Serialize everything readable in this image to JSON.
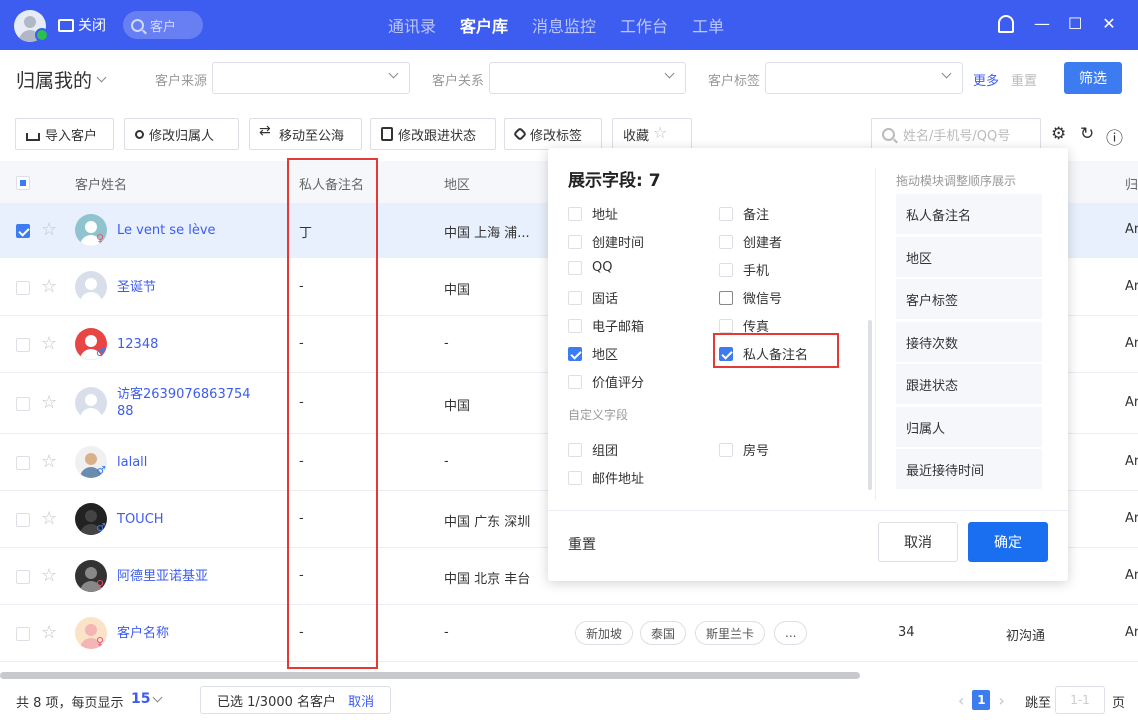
{
  "topbar": {
    "close_label": "关闭",
    "search_placeholder": "客户",
    "nav": [
      "通讯录",
      "客户库",
      "消息监控",
      "工作台",
      "工单"
    ],
    "active_nav": "客户库"
  },
  "filters": {
    "owner": "归属我的",
    "source_label": "客户来源",
    "relation_label": "客户关系",
    "tag_label": "客户标签",
    "more": "更多",
    "reset": "重置",
    "filter_btn": "筛选"
  },
  "toolbar": {
    "import": "导入客户",
    "change_owner": "修改归属人",
    "move_public": "移动至公海",
    "change_status": "修改跟进状态",
    "change_tag": "修改标签",
    "favorite": "收藏",
    "search_placeholder": "姓名/手机号/QQ号"
  },
  "table": {
    "headers": {
      "name": "客户姓名",
      "private_note": "私人备注名",
      "region": "地区",
      "owner_short": "归"
    },
    "rows": [
      {
        "name": "Le vent se lève",
        "note": "丁",
        "region": "中国 上海 浦...",
        "gender": "♀",
        "selected": true
      },
      {
        "name": "圣诞节",
        "note": "-",
        "region": "中国",
        "gender": "",
        "selected": false
      },
      {
        "name": "12348",
        "note": "-",
        "region": "-",
        "gender": "♂",
        "selected": false
      },
      {
        "name_line1": "访客2639076863754",
        "name_line2": "88",
        "note": "-",
        "region": "中国",
        "gender": "",
        "selected": false
      },
      {
        "name": "lalall",
        "note": "-",
        "region": "-",
        "gender": "♂",
        "selected": false
      },
      {
        "name": "TOUCH",
        "note": "-",
        "region": "中国 广东 深圳",
        "gender": "♂",
        "selected": false
      },
      {
        "name": "阿德里亚诺基亚",
        "note": "-",
        "region": "中国 北京 丰台",
        "gender": "♀",
        "selected": false
      },
      {
        "name": "客户名称",
        "note": "-",
        "region": "-",
        "gender": "♀",
        "selected": false,
        "tags": [
          "新加坡",
          "泰国",
          "斯里兰卡",
          "..."
        ],
        "visits": "34",
        "status": "初沟通"
      }
    ],
    "trailing_text": "Ar"
  },
  "popup": {
    "title": "展示字段: 7",
    "left_col": [
      {
        "label": "地址",
        "checked": false
      },
      {
        "label": "创建时间",
        "checked": false
      },
      {
        "label": "QQ",
        "checked": false
      },
      {
        "label": "固话",
        "checked": false
      },
      {
        "label": "电子邮箱",
        "checked": false
      },
      {
        "label": "地区",
        "checked": true
      },
      {
        "label": "价值评分",
        "checked": false
      }
    ],
    "right_col": [
      {
        "label": "备注",
        "checked": false
      },
      {
        "label": "创建者",
        "checked": false
      },
      {
        "label": "手机",
        "checked": false
      },
      {
        "label": "微信号",
        "checked": false
      },
      {
        "label": "传真",
        "checked": false
      },
      {
        "label": "私人备注名",
        "checked": true
      }
    ],
    "custom_section": "自定义字段",
    "custom_left": [
      {
        "label": "组团",
        "checked": false
      },
      {
        "label": "邮件地址",
        "checked": false
      }
    ],
    "custom_right": [
      {
        "label": "房号",
        "checked": false
      }
    ],
    "drag_hint": "拖动模块调整顺序展示",
    "order": [
      "私人备注名",
      "地区",
      "客户标签",
      "接待次数",
      "跟进状态",
      "归属人",
      "最近接待时间"
    ],
    "reset": "重置",
    "cancel": "取消",
    "confirm": "确定"
  },
  "footer": {
    "total_text": "共 8 项，每页显示",
    "per_page": "15",
    "selected_prefix": "已选",
    "selected_count": "1/3000",
    "selected_suffix": "名客户",
    "cancel": "取消",
    "current_page": "1",
    "jump_label": "跳至",
    "jump_placeholder": "1-1",
    "page_unit": "页"
  },
  "colors": {
    "brand": "#3d5cf0",
    "highlight_red": "#e53935",
    "primary_button": "#1a6ff0"
  }
}
